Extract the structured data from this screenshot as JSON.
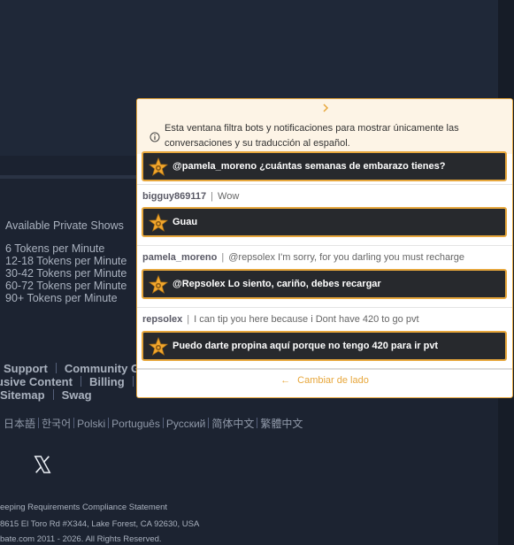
{
  "footer": {
    "shows_title": "Available Private Shows",
    "shows": [
      "6 Tokens per Minute",
      "12-18 Tokens per Minute",
      "30-42 Tokens per Minute",
      "60-72 Tokens per Minute",
      "90+ Tokens per Minute"
    ],
    "links_row1": [
      "Support",
      "Community G"
    ],
    "links_row2": [
      "usive Content",
      "Billing"
    ],
    "links_row3": [
      "Sitemap",
      "Swag"
    ],
    "languages": [
      "日本語",
      "한국어",
      "Polski",
      "Português",
      "Русский",
      "简体中文",
      "繁體中文"
    ],
    "legal1": "eeping Requirements Compliance Statement",
    "legal2": "8615 El Toro Rd #X344, Lake Forest, CA 92630, USA",
    "legal3": "bate.com 2011 - 2026. All Rights Reserved.",
    "social_icon": "x-icon"
  },
  "panel": {
    "info_text": "Esta ventana filtra bots y notificaciones para mostrar únicamente las conversaciones y su traducción al español.",
    "messages": [
      {
        "translation": "@pamela_moreno ¿cuántas semanas de embarazo tienes?"
      },
      {
        "user": "bigguy869117",
        "original": "Wow",
        "translation": "Guau"
      },
      {
        "user": "pamela_moreno",
        "original": "@repsolex I'm sorry, for you darling you must recharge",
        "translation": "@Repsolex Lo siento, cariño, debes recargar"
      },
      {
        "user": "repsolex",
        "original": "I can tip you here because i Dont have 420 to go pvt",
        "translation": "Puedo darte propina aquí porque no tengo 420 para ir pvt"
      }
    ],
    "switch_label": "Cambiar de lado",
    "accent_color": "#e7a73c"
  }
}
